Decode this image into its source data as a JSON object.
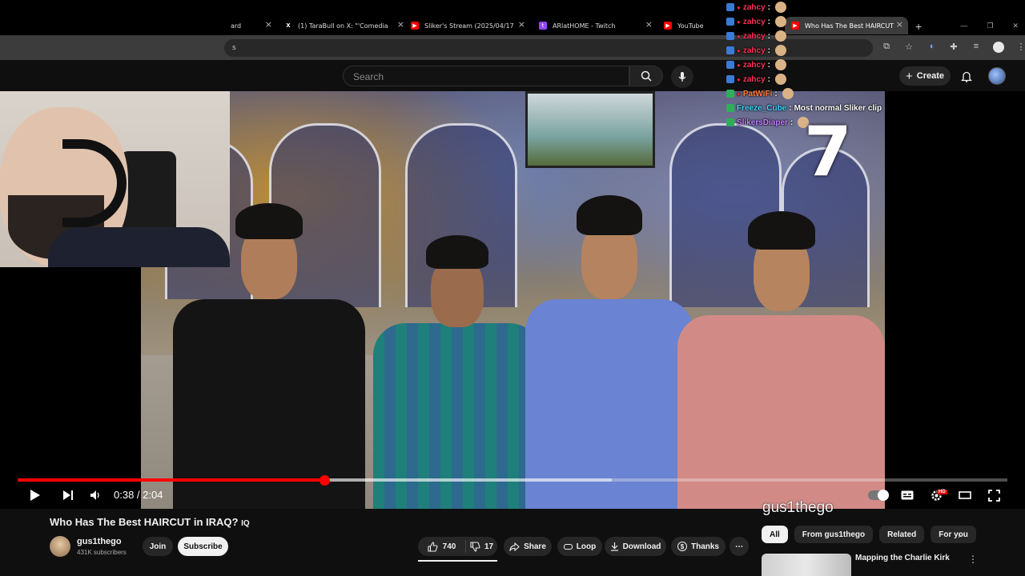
{
  "browser": {
    "tabs": [
      {
        "title": "ard",
        "icon": "blank-icon"
      },
      {
        "title": "(1) TaraBull on X: \"'Comedian' C",
        "icon": "x-icon"
      },
      {
        "title": "Sliker's Stream (2025/04/17)(C",
        "icon": "youtube-icon"
      },
      {
        "title": "ARlatHOME - Twitch",
        "icon": "twitch-icon"
      },
      {
        "title": "YouTube",
        "icon": "youtube-icon"
      },
      {
        "title": "Who Has The Best HAIRCUT in",
        "icon": "youtube-icon",
        "active": true
      }
    ],
    "address_fragment": "s"
  },
  "youtube_header": {
    "search_placeholder": "Search",
    "create_label": "Create"
  },
  "chat": [
    {
      "user": "zahcy",
      "message": "",
      "color": "#ff2d55"
    },
    {
      "user": "zahcy",
      "message": "",
      "color": "#ff2d55"
    },
    {
      "user": "zahcy",
      "message": "",
      "color": "#ff2d55"
    },
    {
      "user": "zahcy",
      "message": "",
      "color": "#ff2d55"
    },
    {
      "user": "zahcy",
      "message": "",
      "color": "#ff2d55"
    },
    {
      "user": "zahcy",
      "message": "",
      "color": "#ff2d55"
    },
    {
      "user": "PatWiFi",
      "message": "",
      "color": "#ff7a3d"
    },
    {
      "user": "Freeze_Cube",
      "message": "Most normal Sliker clip",
      "color": "#3fd6ff"
    },
    {
      "user": "SlikersDiaper",
      "message": "",
      "color": "#c47cff"
    }
  ],
  "overlay_number": "7",
  "watermark": "gus1thego",
  "player": {
    "current_time": "0:38",
    "separator": " / ",
    "duration": "2:04",
    "progress_fraction": 0.31,
    "buffer_fraction": 0.6,
    "hd_badge": "HD"
  },
  "video": {
    "title": "Who Has The Best HAIRCUT in IRAQ? 🇮🇶",
    "title_text": "Who Has The Best HAIRCUT in IRAQ?",
    "flag_label": "IQ",
    "channel_name": "gus1thego",
    "subscribers": "431K subscribers",
    "join_label": "Join",
    "subscribe_label": "Subscribe",
    "likes": "740",
    "dislikes": "17",
    "share_label": "Share",
    "loop_label": "Loop",
    "download_label": "Download",
    "thanks_label": "Thanks",
    "more_label": "⋯"
  },
  "recommendations": {
    "chips": [
      "All",
      "From gus1thego",
      "Related",
      "For you"
    ],
    "first_title": "Mapping the Charlie Kirk"
  },
  "colors": {
    "accent": "#ff0000",
    "bg": "#0f0f0f",
    "pill": "#272727"
  }
}
